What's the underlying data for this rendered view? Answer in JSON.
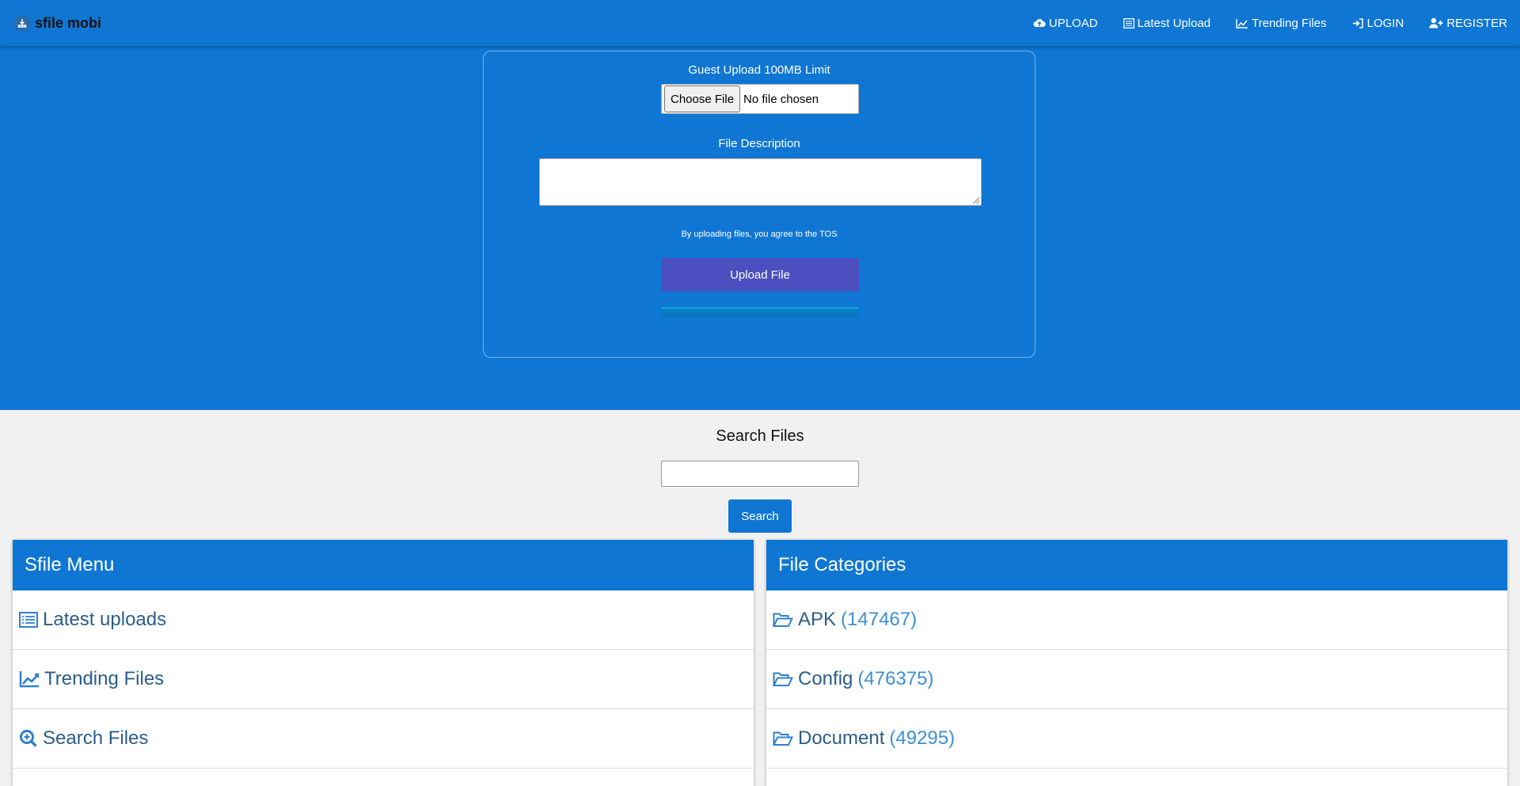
{
  "brand": {
    "name": "sfile mobi"
  },
  "nav": {
    "items": [
      {
        "label": "UPLOAD",
        "icon": "cloud-upload-icon"
      },
      {
        "label": "Latest Upload",
        "icon": "list-icon"
      },
      {
        "label": "Trending Files",
        "icon": "trend-chart-icon"
      },
      {
        "label": "LOGIN",
        "icon": "sign-in-icon"
      },
      {
        "label": "REGISTER",
        "icon": "user-plus-icon"
      }
    ]
  },
  "upload": {
    "limit_label": "Guest Upload 100MB Limit",
    "choose_button": "Choose File",
    "no_file_text": "No file chosen",
    "description_label": "File Description",
    "description_value": "",
    "tos_text": "By uploading files, you agree to the TOS",
    "upload_button": "Upload File"
  },
  "search": {
    "title": "Search Files",
    "input_value": "",
    "button": "Search"
  },
  "menu_panel": {
    "title": "Sfile Menu",
    "items": [
      {
        "label": "Latest uploads",
        "icon": "list-icon"
      },
      {
        "label": "Trending Files",
        "icon": "trend-chart-icon"
      },
      {
        "label": "Search Files",
        "icon": "search-plus-icon"
      }
    ]
  },
  "categories_panel": {
    "title": "File Categories",
    "items": [
      {
        "label": "APK",
        "count": "(147467)",
        "icon": "folder-open-icon"
      },
      {
        "label": "Config",
        "count": "(476375)",
        "icon": "folder-open-icon"
      },
      {
        "label": "Document",
        "count": "(49295)",
        "icon": "folder-open-icon"
      }
    ]
  },
  "colors": {
    "primary": "#0f76d3",
    "upload_button": "#4b4fbf",
    "background": "#f1f1f1",
    "link_text": "#2b5d89",
    "count_text": "#3a8fd9"
  }
}
